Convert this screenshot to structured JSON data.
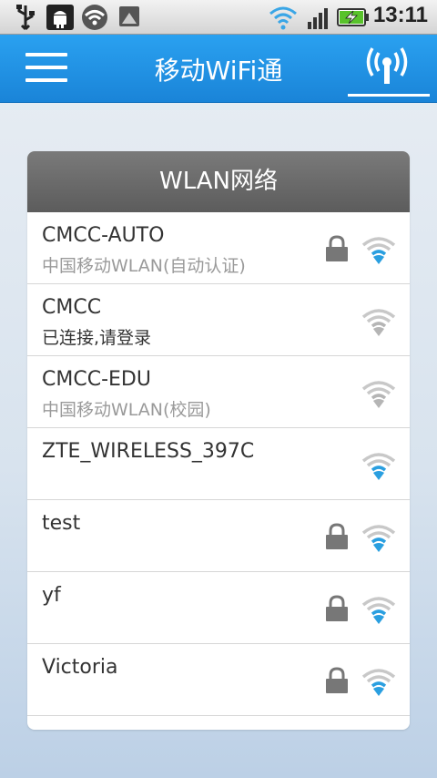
{
  "status_bar": {
    "time": "13:11",
    "left_icons": [
      "usb-icon",
      "android-debug-icon",
      "wifi-available-icon",
      "gallery-icon"
    ],
    "right_icons": [
      "wifi-signal-icon",
      "cell-signal-icon",
      "battery-charging-icon"
    ]
  },
  "header": {
    "title": "移动WiFi通",
    "menu_icon": "menu-icon",
    "action_icon": "antenna-icon"
  },
  "wlan": {
    "title": "WLAN网络",
    "networks": [
      {
        "name": "CMCC-AUTO",
        "subtitle": "中国移动WLAN(自动认证)",
        "locked": true,
        "signal_color": "blue"
      },
      {
        "name": "CMCC",
        "subtitle": "已连接,请登录",
        "locked": false,
        "signal_color": "gray"
      },
      {
        "name": "CMCC-EDU",
        "subtitle": "中国移动WLAN(校园)",
        "locked": false,
        "signal_color": "gray"
      },
      {
        "name": "ZTE_WIRELESS_397C",
        "subtitle": "",
        "locked": false,
        "signal_color": "blue"
      },
      {
        "name": "test",
        "subtitle": "",
        "locked": true,
        "signal_color": "blue"
      },
      {
        "name": "yf",
        "subtitle": "",
        "locked": true,
        "signal_color": "blue"
      },
      {
        "name": "Victoria",
        "subtitle": "",
        "locked": true,
        "signal_color": "blue"
      }
    ]
  },
  "colors": {
    "titlebar": "#1e8fe0",
    "wifi_blue": "#2a9fe0",
    "wifi_gray": "#b5b5b5",
    "card_header": "#666666",
    "lock": "#777777"
  }
}
